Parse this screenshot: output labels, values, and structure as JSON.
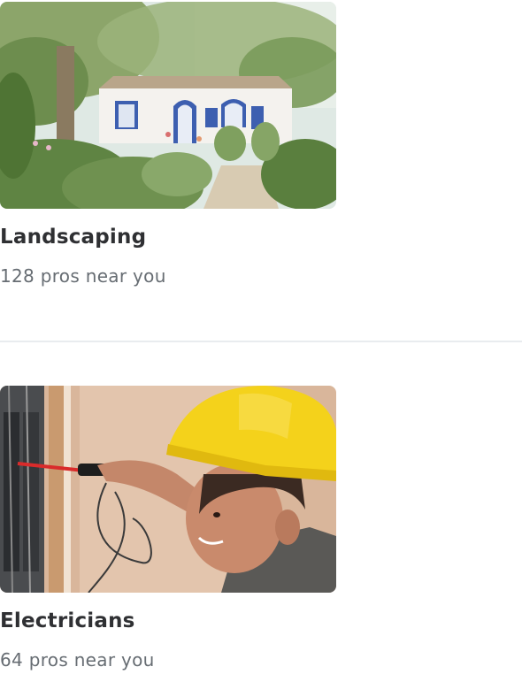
{
  "categories": [
    {
      "title": "Landscaping",
      "subtitle": "128 pros near you",
      "image_icon": "landscaping-photo"
    },
    {
      "title": "Electricians",
      "subtitle": "64 pros near you",
      "image_icon": "electrician-photo"
    }
  ],
  "colors": {
    "title": "#2f3033",
    "subtitle": "#676d73",
    "divider": "#e9ecef"
  }
}
